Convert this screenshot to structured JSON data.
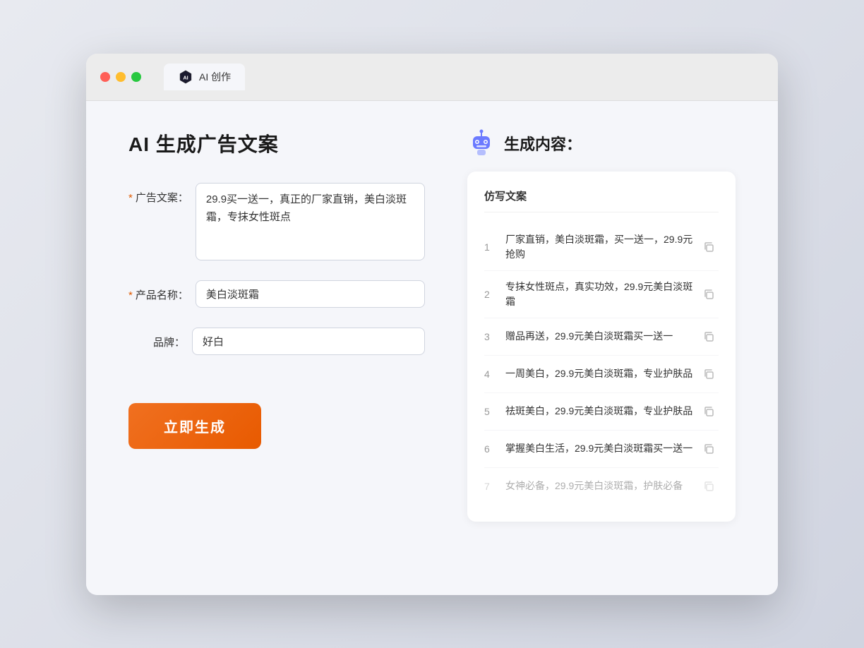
{
  "browser": {
    "tab_label": "AI 创作"
  },
  "left_panel": {
    "title": "AI 生成广告文案",
    "form": {
      "ad_copy_label": "广告文案：",
      "ad_copy_required": true,
      "ad_copy_value": "29.9买一送一，真正的厂家直销，美白淡斑霜，专抹女性斑点",
      "product_name_label": "产品名称：",
      "product_name_required": true,
      "product_name_value": "美白淡斑霜",
      "brand_label": "品牌：",
      "brand_required": false,
      "brand_value": "好白"
    },
    "generate_btn_label": "立即生成"
  },
  "right_panel": {
    "title": "生成内容：",
    "table_header": "仿写文案",
    "results": [
      {
        "num": "1",
        "text": "厂家直销，美白淡斑霜，买一送一，29.9元抢购",
        "faded": false
      },
      {
        "num": "2",
        "text": "专抹女性斑点，真实功效，29.9元美白淡斑霜",
        "faded": false
      },
      {
        "num": "3",
        "text": "赠品再送，29.9元美白淡斑霜买一送一",
        "faded": false
      },
      {
        "num": "4",
        "text": "一周美白，29.9元美白淡斑霜，专业护肤品",
        "faded": false
      },
      {
        "num": "5",
        "text": "祛斑美白，29.9元美白淡斑霜，专业护肤品",
        "faded": false
      },
      {
        "num": "6",
        "text": "掌握美白生活，29.9元美白淡斑霜买一送一",
        "faded": false
      },
      {
        "num": "7",
        "text": "女神必备，29.9元美白淡斑霜，护肤必备",
        "faded": true
      }
    ]
  }
}
